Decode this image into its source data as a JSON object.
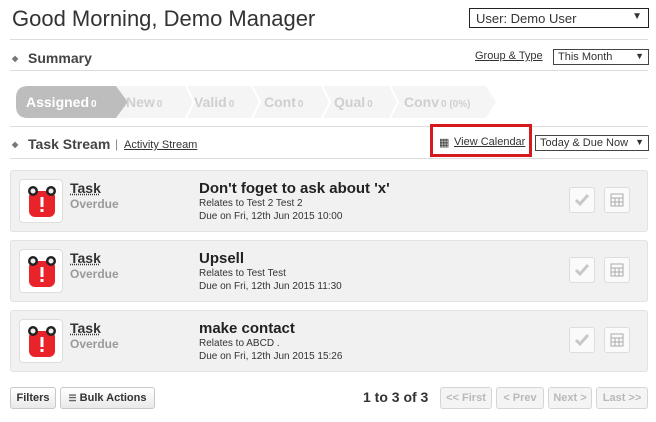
{
  "header": {
    "greeting": "Good Morning, Demo Manager",
    "user_select": "User: Demo User"
  },
  "summary": {
    "title": "Summary",
    "group_type_link": "Group & Type",
    "period_select": "This Month",
    "stages": [
      {
        "label": "Assigned",
        "count": "0"
      },
      {
        "label": "New",
        "count": "0"
      },
      {
        "label": "Valid",
        "count": "0"
      },
      {
        "label": "Cont",
        "count": "0"
      },
      {
        "label": "Qual",
        "count": "0"
      },
      {
        "label": "Conv",
        "count": "0 (0%)"
      }
    ]
  },
  "stream": {
    "title": "Task Stream",
    "separator": "|",
    "activity_link": "Activity Stream",
    "view_calendar": "View Calendar",
    "filter_select": "Today & Due Now"
  },
  "tasks": [
    {
      "type": "Task",
      "status": "Overdue",
      "title": "Don't foget to ask about 'x'",
      "relates": "Relates to Test 2 Test 2",
      "due": "Due on Fri, 12th Jun 2015 10:00"
    },
    {
      "type": "Task",
      "status": "Overdue",
      "title": "Upsell",
      "relates": "Relates to Test Test",
      "due": "Due on Fri, 12th Jun 2015 11:30"
    },
    {
      "type": "Task",
      "status": "Overdue",
      "title": "make contact",
      "relates": "Relates to ABCD .",
      "due": "Due on Fri, 12th Jun 2015 15:26"
    }
  ],
  "footer": {
    "filters": "Filters",
    "bulk_actions": "Bulk Actions",
    "count": "1 to 3 of 3",
    "first": "<< First",
    "prev": "< Prev",
    "next": "Next >",
    "last": "Last >>"
  },
  "colors": {
    "accent_red": "#e8232a",
    "highlight": "#d4191f",
    "stage_active": "#bdbdbd"
  }
}
